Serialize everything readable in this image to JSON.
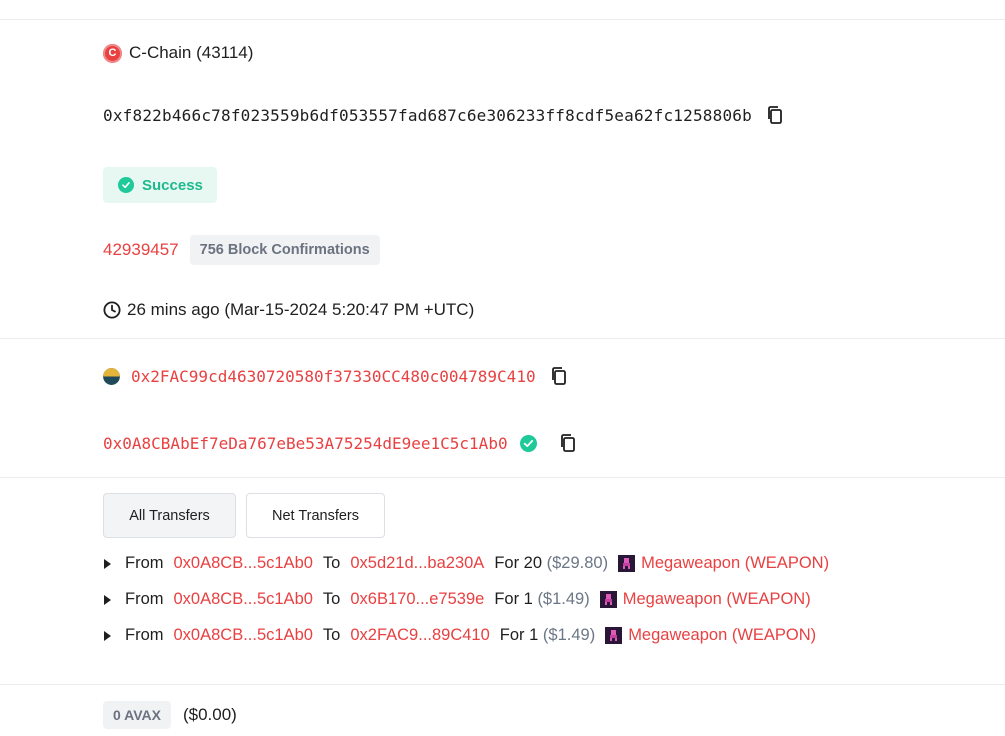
{
  "chain": {
    "name": "C-Chain (43114)",
    "logo_letter": "C"
  },
  "tx_hash": "0xf822b466c78f023559b6df053557fad687c6e306233ff8cdf5ea62fc1258806b",
  "status": {
    "label": "Success",
    "color": "#1fb98d"
  },
  "block": {
    "number": "42939457",
    "confirmations": "756 Block Confirmations"
  },
  "timestamp": "26 mins ago (Mar-15-2024 5:20:47 PM +UTC)",
  "from_address": "0x2FAC99cd4630720580f37330CC480c004789C410",
  "to_address": "0x0A8CBAbEf7eDa767eBe53A75254dE9ee1C5c1Ab0",
  "tabs": [
    {
      "label": "All Transfers",
      "active": true
    },
    {
      "label": "Net Transfers",
      "active": false
    }
  ],
  "transfers": [
    {
      "from_label": "From",
      "from": "0x0A8CB...5c1Ab0",
      "to_label": "To",
      "to": "0x5d21d...ba230A",
      "for_label": "For",
      "amount": "20",
      "usd": "($29.80)",
      "token": "Megaweapon (WEAPON)"
    },
    {
      "from_label": "From",
      "from": "0x0A8CB...5c1Ab0",
      "to_label": "To",
      "to": "0x6B170...e7539e",
      "for_label": "For",
      "amount": "1",
      "usd": "($1.49)",
      "token": "Megaweapon (WEAPON)"
    },
    {
      "from_label": "From",
      "from": "0x0A8CB...5c1Ab0",
      "to_label": "To",
      "to": "0x2FAC9...89C410",
      "for_label": "For",
      "amount": "1",
      "usd": "($1.49)",
      "token": "Megaweapon (WEAPON)"
    }
  ],
  "value": {
    "amount": "0 AVAX",
    "usd": "($0.00)"
  },
  "colors": {
    "accent": "#e84142",
    "success": "#1fc99a",
    "muted": "#6b7785"
  },
  "icons": {
    "chain": "avalanche-c-icon",
    "copy": "copy-icon",
    "status": "check-circle-icon",
    "clock": "clock-icon",
    "verified": "verified-check-icon",
    "expand": "triangle-right-icon",
    "token": "megaweapon-token-icon"
  }
}
